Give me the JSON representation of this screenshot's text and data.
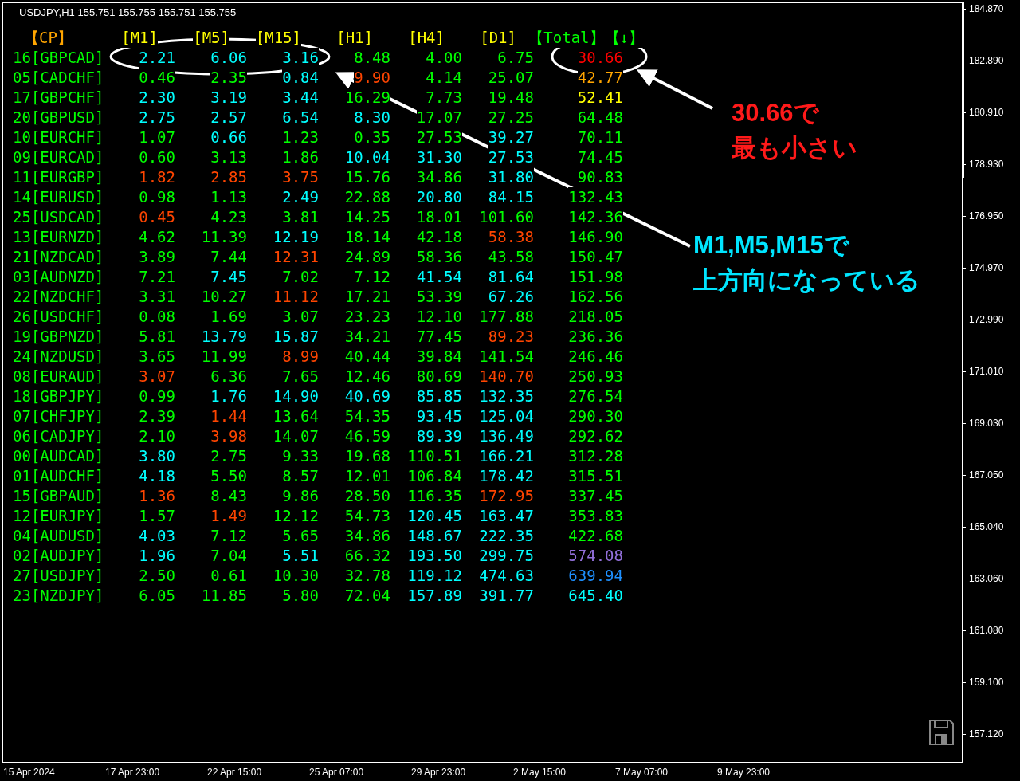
{
  "chart_header": "USDJPY,H1  155.751 155.755 155.751 155.755",
  "columns": [
    {
      "label": "【CP】",
      "color": "#ffa500"
    },
    {
      "label": "[M1]",
      "color": "#ffff00"
    },
    {
      "label": "[M5]",
      "color": "#ffff00"
    },
    {
      "label": "[M15]",
      "color": "#ffff00"
    },
    {
      "label": "[H1]",
      "color": "#ffff00"
    },
    {
      "label": "[H4]",
      "color": "#ffff00"
    },
    {
      "label": "[D1]",
      "color": "#ffff00"
    },
    {
      "label": "【Total】【↓】",
      "color": "#00ff00"
    }
  ],
  "rows": [
    {
      "pair": "16[GBPCAD]",
      "cells": [
        {
          "v": "2.21",
          "color": "#00ffff"
        },
        {
          "v": "6.06",
          "color": "#00ffff"
        },
        {
          "v": "3.16",
          "color": "#00ffff"
        },
        {
          "v": "8.48",
          "color": "#00ff00"
        },
        {
          "v": "4.00",
          "color": "#00ff00"
        },
        {
          "v": "6.75",
          "color": "#00ff00"
        },
        {
          "v": "30.66",
          "color": "#ff0000"
        }
      ]
    },
    {
      "pair": "05[CADCHF]",
      "cells": [
        {
          "v": "0.46",
          "color": "#00ff00"
        },
        {
          "v": "2.35",
          "color": "#00ff00"
        },
        {
          "v": "0.84",
          "color": "#00ffff"
        },
        {
          "v": "9.90",
          "color": "#ff4500"
        },
        {
          "v": "4.14",
          "color": "#00ff00"
        },
        {
          "v": "25.07",
          "color": "#00ff00"
        },
        {
          "v": "42.77",
          "color": "#ffa500"
        }
      ]
    },
    {
      "pair": "17[GBPCHF]",
      "cells": [
        {
          "v": "2.30",
          "color": "#00ffff"
        },
        {
          "v": "3.19",
          "color": "#00ffff"
        },
        {
          "v": "3.44",
          "color": "#00ffff"
        },
        {
          "v": "16.29",
          "color": "#00ff00"
        },
        {
          "v": "7.73",
          "color": "#00ff00"
        },
        {
          "v": "19.48",
          "color": "#00ff00"
        },
        {
          "v": "52.41",
          "color": "#ffff00"
        }
      ]
    },
    {
      "pair": "20[GBPUSD]",
      "cells": [
        {
          "v": "2.75",
          "color": "#00ffff"
        },
        {
          "v": "2.57",
          "color": "#00ffff"
        },
        {
          "v": "6.54",
          "color": "#00ffff"
        },
        {
          "v": "8.30",
          "color": "#00ffff"
        },
        {
          "v": "17.07",
          "color": "#00ff00"
        },
        {
          "v": "27.25",
          "color": "#00ff00"
        },
        {
          "v": "64.48",
          "color": "#00ff00"
        }
      ]
    },
    {
      "pair": "10[EURCHF]",
      "cells": [
        {
          "v": "1.07",
          "color": "#00ff00"
        },
        {
          "v": "0.66",
          "color": "#00ffff"
        },
        {
          "v": "1.23",
          "color": "#00ff00"
        },
        {
          "v": "0.35",
          "color": "#00ff00"
        },
        {
          "v": "27.53",
          "color": "#00ff00"
        },
        {
          "v": "39.27",
          "color": "#00ffff"
        },
        {
          "v": "70.11",
          "color": "#00ff00"
        }
      ]
    },
    {
      "pair": "09[EURCAD]",
      "cells": [
        {
          "v": "0.60",
          "color": "#00ff00"
        },
        {
          "v": "3.13",
          "color": "#00ff00"
        },
        {
          "v": "1.86",
          "color": "#00ff00"
        },
        {
          "v": "10.04",
          "color": "#00ffff"
        },
        {
          "v": "31.30",
          "color": "#00ffff"
        },
        {
          "v": "27.53",
          "color": "#00ffff"
        },
        {
          "v": "74.45",
          "color": "#00ff00"
        }
      ]
    },
    {
      "pair": "11[EURGBP]",
      "cells": [
        {
          "v": "1.82",
          "color": "#ff4500"
        },
        {
          "v": "2.85",
          "color": "#ff4500"
        },
        {
          "v": "3.75",
          "color": "#ff4500"
        },
        {
          "v": "15.76",
          "color": "#00ff00"
        },
        {
          "v": "34.86",
          "color": "#00ff00"
        },
        {
          "v": "31.80",
          "color": "#00ffff"
        },
        {
          "v": "90.83",
          "color": "#00ff00"
        }
      ]
    },
    {
      "pair": "14[EURUSD]",
      "cells": [
        {
          "v": "0.98",
          "color": "#00ff00"
        },
        {
          "v": "1.13",
          "color": "#00ff00"
        },
        {
          "v": "2.49",
          "color": "#00ffff"
        },
        {
          "v": "22.88",
          "color": "#00ff00"
        },
        {
          "v": "20.80",
          "color": "#00ffff"
        },
        {
          "v": "84.15",
          "color": "#00ffff"
        },
        {
          "v": "132.43",
          "color": "#00ff00"
        }
      ]
    },
    {
      "pair": "25[USDCAD]",
      "cells": [
        {
          "v": "0.45",
          "color": "#ff4500"
        },
        {
          "v": "4.23",
          "color": "#00ff00"
        },
        {
          "v": "3.81",
          "color": "#00ff00"
        },
        {
          "v": "14.25",
          "color": "#00ff00"
        },
        {
          "v": "18.01",
          "color": "#00ff00"
        },
        {
          "v": "101.60",
          "color": "#00ff00"
        },
        {
          "v": "142.36",
          "color": "#00ff00"
        }
      ]
    },
    {
      "pair": "13[EURNZD]",
      "cells": [
        {
          "v": "4.62",
          "color": "#00ff00"
        },
        {
          "v": "11.39",
          "color": "#00ff00"
        },
        {
          "v": "12.19",
          "color": "#00ffff"
        },
        {
          "v": "18.14",
          "color": "#00ff00"
        },
        {
          "v": "42.18",
          "color": "#00ff00"
        },
        {
          "v": "58.38",
          "color": "#ff4500"
        },
        {
          "v": "146.90",
          "color": "#00ff00"
        }
      ]
    },
    {
      "pair": "21[NZDCAD]",
      "cells": [
        {
          "v": "3.89",
          "color": "#00ff00"
        },
        {
          "v": "7.44",
          "color": "#00ff00"
        },
        {
          "v": "12.31",
          "color": "#ff4500"
        },
        {
          "v": "24.89",
          "color": "#00ff00"
        },
        {
          "v": "58.36",
          "color": "#00ff00"
        },
        {
          "v": "43.58",
          "color": "#00ff00"
        },
        {
          "v": "150.47",
          "color": "#00ff00"
        }
      ]
    },
    {
      "pair": "03[AUDNZD]",
      "cells": [
        {
          "v": "7.21",
          "color": "#00ff00"
        },
        {
          "v": "7.45",
          "color": "#00ffff"
        },
        {
          "v": "7.02",
          "color": "#00ff00"
        },
        {
          "v": "7.12",
          "color": "#00ff00"
        },
        {
          "v": "41.54",
          "color": "#00ffff"
        },
        {
          "v": "81.64",
          "color": "#00ffff"
        },
        {
          "v": "151.98",
          "color": "#00ff00"
        }
      ]
    },
    {
      "pair": "22[NZDCHF]",
      "cells": [
        {
          "v": "3.31",
          "color": "#00ff00"
        },
        {
          "v": "10.27",
          "color": "#00ff00"
        },
        {
          "v": "11.12",
          "color": "#ff4500"
        },
        {
          "v": "17.21",
          "color": "#00ff00"
        },
        {
          "v": "53.39",
          "color": "#00ff00"
        },
        {
          "v": "67.26",
          "color": "#00ffff"
        },
        {
          "v": "162.56",
          "color": "#00ff00"
        }
      ]
    },
    {
      "pair": "26[USDCHF]",
      "cells": [
        {
          "v": "0.08",
          "color": "#00ff00"
        },
        {
          "v": "1.69",
          "color": "#00ff00"
        },
        {
          "v": "3.07",
          "color": "#00ff00"
        },
        {
          "v": "23.23",
          "color": "#00ff00"
        },
        {
          "v": "12.10",
          "color": "#00ff00"
        },
        {
          "v": "177.88",
          "color": "#00ff00"
        },
        {
          "v": "218.05",
          "color": "#00ff00"
        }
      ]
    },
    {
      "pair": "19[GBPNZD]",
      "cells": [
        {
          "v": "5.81",
          "color": "#00ff00"
        },
        {
          "v": "13.79",
          "color": "#00ffff"
        },
        {
          "v": "15.87",
          "color": "#00ffff"
        },
        {
          "v": "34.21",
          "color": "#00ff00"
        },
        {
          "v": "77.45",
          "color": "#00ff00"
        },
        {
          "v": "89.23",
          "color": "#ff4500"
        },
        {
          "v": "236.36",
          "color": "#00ff00"
        }
      ]
    },
    {
      "pair": "24[NZDUSD]",
      "cells": [
        {
          "v": "3.65",
          "color": "#00ff00"
        },
        {
          "v": "11.99",
          "color": "#00ff00"
        },
        {
          "v": "8.99",
          "color": "#ff4500"
        },
        {
          "v": "40.44",
          "color": "#00ff00"
        },
        {
          "v": "39.84",
          "color": "#00ff00"
        },
        {
          "v": "141.54",
          "color": "#00ff00"
        },
        {
          "v": "246.46",
          "color": "#00ff00"
        }
      ]
    },
    {
      "pair": "08[EURAUD]",
      "cells": [
        {
          "v": "3.07",
          "color": "#ff4500"
        },
        {
          "v": "6.36",
          "color": "#00ff00"
        },
        {
          "v": "7.65",
          "color": "#00ff00"
        },
        {
          "v": "12.46",
          "color": "#00ff00"
        },
        {
          "v": "80.69",
          "color": "#00ff00"
        },
        {
          "v": "140.70",
          "color": "#ff4500"
        },
        {
          "v": "250.93",
          "color": "#00ff00"
        }
      ]
    },
    {
      "pair": "18[GBPJPY]",
      "cells": [
        {
          "v": "0.99",
          "color": "#00ff00"
        },
        {
          "v": "1.76",
          "color": "#00ffff"
        },
        {
          "v": "14.90",
          "color": "#00ffff"
        },
        {
          "v": "40.69",
          "color": "#00ffff"
        },
        {
          "v": "85.85",
          "color": "#00ffff"
        },
        {
          "v": "132.35",
          "color": "#00ffff"
        },
        {
          "v": "276.54",
          "color": "#00ff00"
        }
      ]
    },
    {
      "pair": "07[CHFJPY]",
      "cells": [
        {
          "v": "2.39",
          "color": "#00ff00"
        },
        {
          "v": "1.44",
          "color": "#ff4500"
        },
        {
          "v": "13.64",
          "color": "#00ff00"
        },
        {
          "v": "54.35",
          "color": "#00ff00"
        },
        {
          "v": "93.45",
          "color": "#00ffff"
        },
        {
          "v": "125.04",
          "color": "#00ffff"
        },
        {
          "v": "290.30",
          "color": "#00ff00"
        }
      ]
    },
    {
      "pair": "06[CADJPY]",
      "cells": [
        {
          "v": "2.10",
          "color": "#00ff00"
        },
        {
          "v": "3.98",
          "color": "#ff4500"
        },
        {
          "v": "14.07",
          "color": "#00ff00"
        },
        {
          "v": "46.59",
          "color": "#00ff00"
        },
        {
          "v": "89.39",
          "color": "#00ffff"
        },
        {
          "v": "136.49",
          "color": "#00ffff"
        },
        {
          "v": "292.62",
          "color": "#00ff00"
        }
      ]
    },
    {
      "pair": "00[AUDCAD]",
      "cells": [
        {
          "v": "3.80",
          "color": "#00ffff"
        },
        {
          "v": "2.75",
          "color": "#00ff00"
        },
        {
          "v": "9.33",
          "color": "#00ff00"
        },
        {
          "v": "19.68",
          "color": "#00ff00"
        },
        {
          "v": "110.51",
          "color": "#00ff00"
        },
        {
          "v": "166.21",
          "color": "#00ffff"
        },
        {
          "v": "312.28",
          "color": "#00ff00"
        }
      ]
    },
    {
      "pair": "01[AUDCHF]",
      "cells": [
        {
          "v": "4.18",
          "color": "#00ffff"
        },
        {
          "v": "5.50",
          "color": "#00ff00"
        },
        {
          "v": "8.57",
          "color": "#00ff00"
        },
        {
          "v": "12.01",
          "color": "#00ff00"
        },
        {
          "v": "106.84",
          "color": "#00ff00"
        },
        {
          "v": "178.42",
          "color": "#00ffff"
        },
        {
          "v": "315.51",
          "color": "#00ff00"
        }
      ]
    },
    {
      "pair": "15[GBPAUD]",
      "cells": [
        {
          "v": "1.36",
          "color": "#ff4500"
        },
        {
          "v": "8.43",
          "color": "#00ff00"
        },
        {
          "v": "9.86",
          "color": "#00ff00"
        },
        {
          "v": "28.50",
          "color": "#00ff00"
        },
        {
          "v": "116.35",
          "color": "#00ff00"
        },
        {
          "v": "172.95",
          "color": "#ff4500"
        },
        {
          "v": "337.45",
          "color": "#00ff00"
        }
      ]
    },
    {
      "pair": "12[EURJPY]",
      "cells": [
        {
          "v": "1.57",
          "color": "#00ff00"
        },
        {
          "v": "1.49",
          "color": "#ff4500"
        },
        {
          "v": "12.12",
          "color": "#00ff00"
        },
        {
          "v": "54.73",
          "color": "#00ff00"
        },
        {
          "v": "120.45",
          "color": "#00ffff"
        },
        {
          "v": "163.47",
          "color": "#00ffff"
        },
        {
          "v": "353.83",
          "color": "#00ff00"
        }
      ]
    },
    {
      "pair": "04[AUDUSD]",
      "cells": [
        {
          "v": "4.03",
          "color": "#00ffff"
        },
        {
          "v": "7.12",
          "color": "#00ff00"
        },
        {
          "v": "5.65",
          "color": "#00ff00"
        },
        {
          "v": "34.86",
          "color": "#00ff00"
        },
        {
          "v": "148.67",
          "color": "#00ffff"
        },
        {
          "v": "222.35",
          "color": "#00ffff"
        },
        {
          "v": "422.68",
          "color": "#00ff00"
        }
      ]
    },
    {
      "pair": "02[AUDJPY]",
      "cells": [
        {
          "v": "1.96",
          "color": "#00ffff"
        },
        {
          "v": "7.04",
          "color": "#00ff00"
        },
        {
          "v": "5.51",
          "color": "#00ffff"
        },
        {
          "v": "66.32",
          "color": "#00ff00"
        },
        {
          "v": "193.50",
          "color": "#00ffff"
        },
        {
          "v": "299.75",
          "color": "#00ffff"
        },
        {
          "v": "574.08",
          "color": "#9370db"
        }
      ]
    },
    {
      "pair": "27[USDJPY]",
      "cells": [
        {
          "v": "2.50",
          "color": "#00ff00"
        },
        {
          "v": "0.61",
          "color": "#00ff00"
        },
        {
          "v": "10.30",
          "color": "#00ff00"
        },
        {
          "v": "32.78",
          "color": "#00ff00"
        },
        {
          "v": "119.12",
          "color": "#00ffff"
        },
        {
          "v": "474.63",
          "color": "#00ffff"
        },
        {
          "v": "639.94",
          "color": "#1e90ff"
        }
      ]
    },
    {
      "pair": "23[NZDJPY]",
      "cells": [
        {
          "v": "6.05",
          "color": "#00ff00"
        },
        {
          "v": "11.85",
          "color": "#00ff00"
        },
        {
          "v": "5.80",
          "color": "#00ff00"
        },
        {
          "v": "72.04",
          "color": "#00ff00"
        },
        {
          "v": "157.89",
          "color": "#00ffff"
        },
        {
          "v": "391.77",
          "color": "#00ffff"
        },
        {
          "v": "645.40",
          "color": "#00ffff"
        }
      ]
    }
  ],
  "annotations": [
    {
      "lines": [
        "30.66で",
        "最も小さい"
      ],
      "color": "#ff1a1a"
    },
    {
      "lines": [
        "M1,M5,M15で",
        "上方向になっている"
      ],
      "color": "#00e5ff"
    }
  ],
  "price_axis": [
    "184.870",
    "182.890",
    "180.910",
    "178.930",
    "176.950",
    "174.970",
    "172.990",
    "171.010",
    "169.030",
    "167.050",
    "165.040",
    "163.060",
    "161.080",
    "159.100",
    "157.120"
  ],
  "time_axis": [
    "15 Apr 2024",
    "17 Apr 23:00",
    "22 Apr 15:00",
    "25 Apr 07:00",
    "29 Apr 23:00",
    "2 May 15:00",
    "7 May 07:00",
    "9 May 23:00"
  ]
}
